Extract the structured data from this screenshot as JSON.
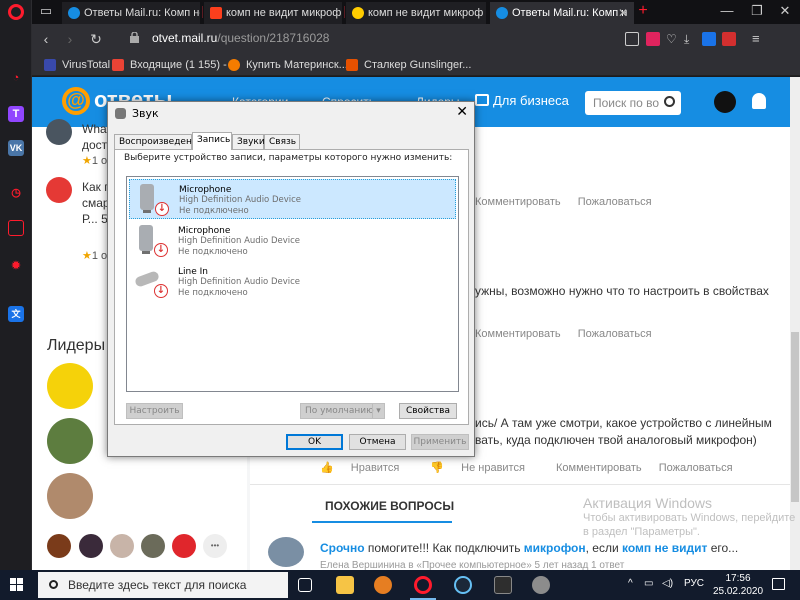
{
  "browser": {
    "tabs": [
      {
        "title": "Ответы Mail.ru: Комп не",
        "favicon": "mailru-answers-icon",
        "color": "#168de2"
      },
      {
        "title": "комп не видит микроф",
        "favicon": "yandex-icon",
        "color": "#fc3f1d"
      },
      {
        "title": "комп не видит микроф",
        "favicon": "youtube-play-icon",
        "color": "#ffcc00"
      },
      {
        "title": "Ответы Mail.ru: Комп н",
        "favicon": "mailru-answers-icon",
        "color": "#168de2"
      }
    ],
    "new_tab": "+",
    "url_host": "otvet.mail.ru",
    "url_path": "/question/218716028",
    "bookmarks": [
      {
        "label": "VirusTotal",
        "icon": "virustotal-icon",
        "color": "#3949ab"
      },
      {
        "label": "Входящие (1 155) -",
        "icon": "gmail-icon",
        "color": "#ea4335"
      },
      {
        "label": "Купить Материнск...",
        "icon": "shop-icon",
        "color": "#f57c00"
      },
      {
        "label": "Сталкер Gunslinger...",
        "icon": "stalker-icon",
        "color": "#e65100"
      }
    ]
  },
  "site": {
    "logo": "ответы",
    "nav": [
      "Категории",
      "Спросить",
      "Лидеры"
    ],
    "business": "Для бизнеса",
    "search_placeholder": "Поиск по во",
    "left_questions": [
      {
        "text": "What... доста...",
        "stars": "1 о"
      },
      {
        "text": "Как п... смар... 4С Р... 5.1 ?",
        "stars": "1 о"
      }
    ],
    "leaders_title": "Лидеры",
    "more": "•••",
    "actions": {
      "like": "Нравится",
      "dislike": "Не нравится",
      "comment": "Комментировать",
      "complain": "Пожаловаться"
    },
    "answer1": "ужны, возможно нужно что то настроить в свойствах",
    "answer2_line1": "ись/ А там уже смотри, какое устройство с линейным",
    "answer2_line2": "вать, куда подключен твой аналоговый микрофон)",
    "similar_title": "ПОХОЖИЕ ВОПРОСЫ",
    "similar_q_prefix": "Срочно",
    "similar_q_text": " помогите!!! Как подключить ",
    "similar_q_bold1": "микрофон",
    "similar_q_mid": ", если ",
    "similar_q_bold2": "комп не видит",
    "similar_q_end": " его...",
    "similar_meta": "Елена Вершинина в «Прочее компьютерное»   5 лет назад       1 ответ"
  },
  "dialog": {
    "title": "Звук",
    "tabs": [
      "Воспроизведение",
      "Запись",
      "Звуки",
      "Связь"
    ],
    "active_tab": "Запись",
    "instruction": "Выберите устройство записи, параметры которого нужно изменить:",
    "devices": [
      {
        "name": "Microphone",
        "driver": "High Definition Audio Device",
        "status": "Не подключено",
        "icon": "microphone-icon",
        "selected": true
      },
      {
        "name": "Microphone",
        "driver": "High Definition Audio Device",
        "status": "Не подключено",
        "icon": "microphone-icon",
        "selected": false
      },
      {
        "name": "Line In",
        "driver": "High Definition Audio Device",
        "status": "Не подключено",
        "icon": "line-in-jack-icon",
        "selected": false
      }
    ],
    "btn_configure": "Настроить",
    "btn_default": "По умолчанию",
    "btn_properties": "Свойства",
    "btn_ok": "OK",
    "btn_cancel": "Отмена",
    "btn_apply": "Применить"
  },
  "watermark": {
    "title": "Активация Windows",
    "text": "Чтобы активировать Windows, перейдите в раздел \"Параметры\"."
  },
  "taskbar": {
    "search_placeholder": "Введите здесь текст для поиска",
    "lang": "РУС",
    "time": "17:56",
    "date": "25.02.2020"
  }
}
